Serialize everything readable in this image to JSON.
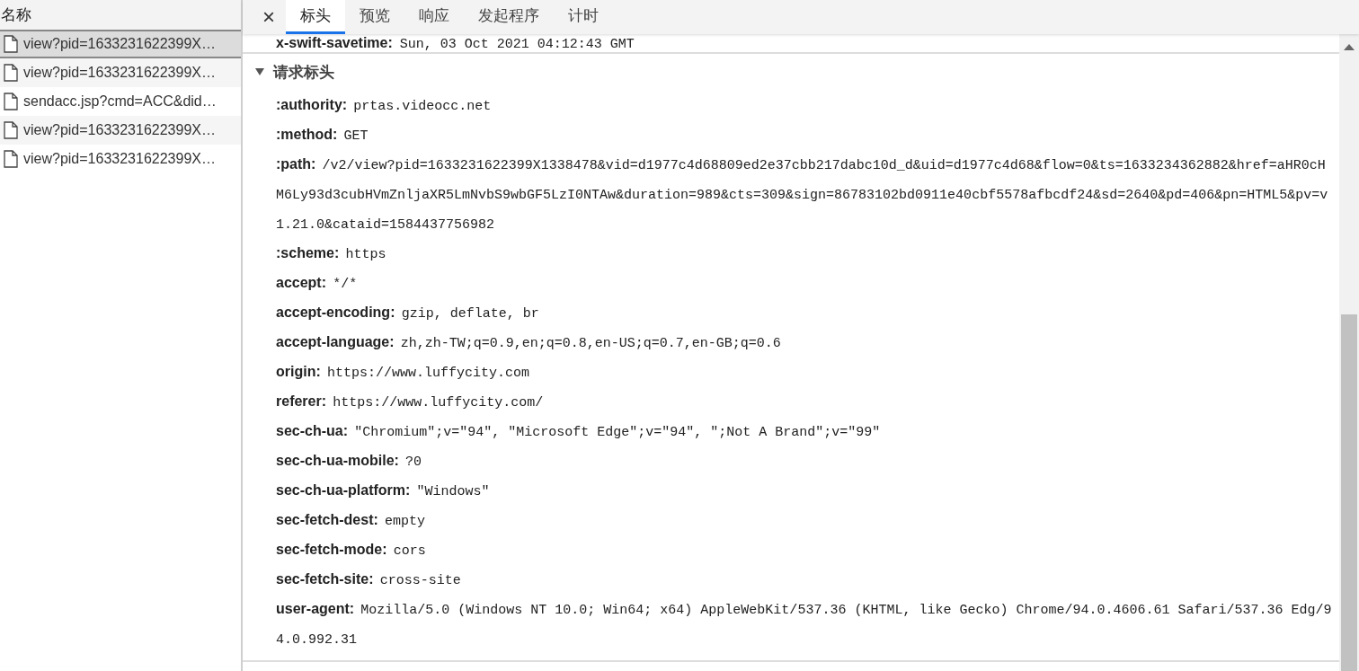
{
  "sidebar": {
    "header": "名称",
    "items": [
      {
        "label": "view?pid=1633231622399X…",
        "selected": true
      },
      {
        "label": "view?pid=1633231622399X…",
        "selected": false
      },
      {
        "label": "sendacc.jsp?cmd=ACC&did…",
        "selected": false
      },
      {
        "label": "view?pid=1633231622399X…",
        "selected": false
      },
      {
        "label": "view?pid=1633231622399X…",
        "selected": false
      }
    ]
  },
  "close": "×",
  "tabs": [
    {
      "label": "标头",
      "selected": true
    },
    {
      "label": "预览",
      "selected": false
    },
    {
      "label": "响应",
      "selected": false
    },
    {
      "label": "发起程序",
      "selected": false
    },
    {
      "label": "计时",
      "selected": false
    }
  ],
  "previous_header": {
    "key": "x-swift-savetime:",
    "value": "Sun, 03 Oct 2021 04:12:43 GMT"
  },
  "section": {
    "title": "请求标头",
    "expanded": true,
    "headers": [
      {
        "key": ":authority:",
        "value": "prtas.videocc.net"
      },
      {
        "key": ":method:",
        "value": "GET"
      },
      {
        "key": ":path:",
        "value": "/v2/view?pid=1633231622399X1338478&vid=d1977c4d68809ed2e37cbb217dabc10d_d&uid=d1977c4d68&flow=0&ts=1633234362882&href=aHR0cHM6Ly93d3cubHVmZnljaXR5LmNvbS9wbGF5LzI0NTAw&duration=989&cts=309&sign=86783102bd0911e40cbf5578afbcdf24&sd=2640&pd=406&pn=HTML5&pv=v1.21.0&cataid=1584437756982"
      },
      {
        "key": ":scheme:",
        "value": "https"
      },
      {
        "key": "accept:",
        "value": "*/*"
      },
      {
        "key": "accept-encoding:",
        "value": "gzip, deflate, br"
      },
      {
        "key": "accept-language:",
        "value": "zh,zh-TW;q=0.9,en;q=0.8,en-US;q=0.7,en-GB;q=0.6"
      },
      {
        "key": "origin:",
        "value": "https://www.luffycity.com"
      },
      {
        "key": "referer:",
        "value": "https://www.luffycity.com/"
      },
      {
        "key": "sec-ch-ua:",
        "value": "\"Chromium\";v=\"94\", \"Microsoft Edge\";v=\"94\", \";Not A Brand\";v=\"99\""
      },
      {
        "key": "sec-ch-ua-mobile:",
        "value": "?0"
      },
      {
        "key": "sec-ch-ua-platform:",
        "value": "\"Windows\""
      },
      {
        "key": "sec-fetch-dest:",
        "value": "empty"
      },
      {
        "key": "sec-fetch-mode:",
        "value": "cors"
      },
      {
        "key": "sec-fetch-site:",
        "value": "cross-site"
      },
      {
        "key": "user-agent:",
        "value": "Mozilla/5.0 (Windows NT 10.0; Win64; x64) AppleWebKit/537.36 (KHTML, like Gecko) Chrome/94.0.4606.61 Safari/537.36 Edg/94.0.992.31"
      }
    ]
  }
}
